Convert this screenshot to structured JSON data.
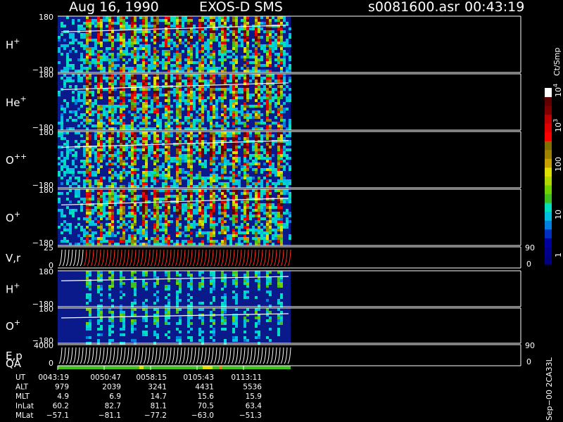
{
  "header": {
    "date": "Aug 16, 1990",
    "instrument": "EXOS-D SMS",
    "file": "s0081600.asr",
    "time": "00:43:19"
  },
  "colorbar": {
    "unit": "Ct/Smp",
    "ticks": [
      "1",
      "10",
      "100",
      "10^3",
      "10^4"
    ],
    "colors": [
      "#000080",
      "#00008c",
      "#0000a0",
      "#0030c0",
      "#0080e0",
      "#00c0e0",
      "#00e0c0",
      "#40c020",
      "#70d000",
      "#b0d800",
      "#e0e000",
      "#c8a000",
      "#a08000",
      "#807000",
      "#ff0000",
      "#e00000",
      "#c00000",
      "#800000",
      "#600000",
      "#ffffff"
    ]
  },
  "panels": [
    {
      "id": "h-plus-1",
      "label": "H",
      "sup": "+",
      "ymax": "180",
      "ymin": "−180"
    },
    {
      "id": "he-plus",
      "label": "He",
      "sup": "+",
      "ymax": "180",
      "ymin": "−180"
    },
    {
      "id": "o-plusplus",
      "label": "O",
      "sup": "++",
      "ymax": "180",
      "ymin": "−180"
    },
    {
      "id": "o-plus-1",
      "label": "O",
      "sup": "+",
      "ymax": "180",
      "ymin": "−180"
    },
    {
      "id": "vr",
      "label": "V,r",
      "sup": "",
      "ymax": "25",
      "ymin": "0",
      "right_top": "90",
      "right_bottom": "0"
    },
    {
      "id": "h-plus-2",
      "label": "H",
      "sup": "+",
      "ymax": "180",
      "ymin": "−180"
    },
    {
      "id": "o-plus-2",
      "label": "O",
      "sup": "+",
      "ymax": "180",
      "ymin": "−180"
    },
    {
      "id": "ep",
      "label": "E,p",
      "sup": "",
      "label2": "QA",
      "ymax": "4000",
      "ymin": "0",
      "right_top": "90",
      "right_bottom": "0"
    }
  ],
  "side_note": "Sep−00 2CA33L",
  "chart_data": {
    "type": "heatmap",
    "title": "Aug 16, 1990   EXOS-D SMS",
    "x_label": "UT",
    "x_ticks": [
      "0043:19",
      "0050:47",
      "0058:15",
      "0105:43",
      "0113:11"
    ],
    "ephemeris": [
      {
        "name": "UT",
        "values": [
          "0043:19",
          "0050:47",
          "0058:15",
          "0105:43",
          "0113:11"
        ]
      },
      {
        "name": "ALT",
        "values": [
          "979",
          "2039",
          "3241",
          "4431",
          "5536"
        ]
      },
      {
        "name": "MLT",
        "values": [
          "4.9",
          "6.9",
          "14.7",
          "15.6",
          "15.9"
        ]
      },
      {
        "name": "InLat",
        "values": [
          "60.2",
          "82.7",
          "81.1",
          "70.5",
          "63.4"
        ]
      },
      {
        "name": "MLat",
        "values": [
          "−57.1",
          "−81.1",
          "−77.2",
          "−63.0",
          "−51.3"
        ]
      }
    ],
    "data_coverage": [
      0,
      0.59
    ]
  }
}
